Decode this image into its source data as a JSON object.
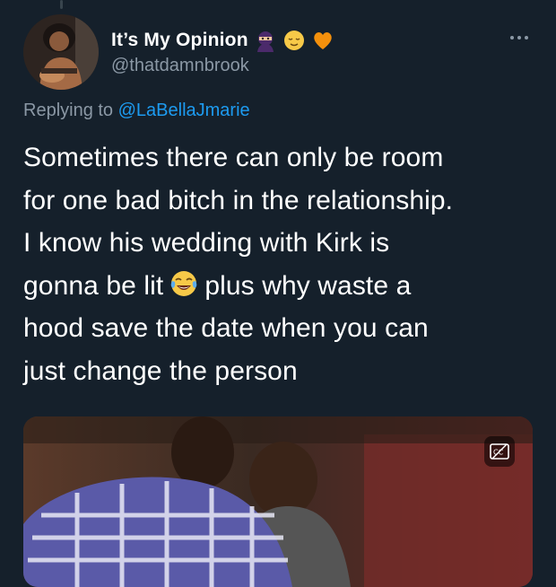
{
  "tweet": {
    "author": {
      "display_name": "It’s My Opinion",
      "handle": "@thatdamnbrook",
      "name_emojis": [
        "ninja-icon",
        "relieved-face-icon",
        "orange-heart-icon"
      ]
    },
    "replying_to": {
      "prefix": "Replying to",
      "mention": "@LaBellaJmarie"
    },
    "text": {
      "line1": "Sometimes there can only be room",
      "line2": "for one bad bitch in the relationship.",
      "line3": "I know his wedding with Kirk is",
      "line4_before": "gonna be lit",
      "line4_emoji": "tears-of-joy-icon",
      "line4_after": "plus why waste a",
      "line5": "hood save the date when you can",
      "line6": "just change the person"
    },
    "media": {
      "type": "video",
      "captions_icon": "closed-captions-icon"
    }
  },
  "colors": {
    "background": "#15202b",
    "secondary_text": "#8b98a5",
    "link": "#1d9bf0"
  }
}
